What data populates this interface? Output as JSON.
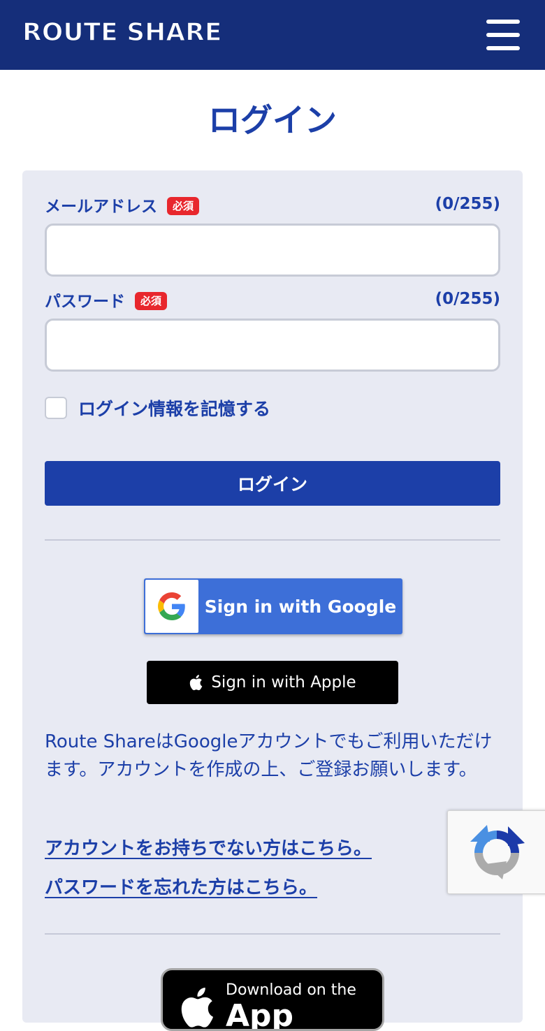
{
  "header": {
    "logo": "ROUTE SHARE"
  },
  "page": {
    "title": "ログイン"
  },
  "form": {
    "email": {
      "label": "メールアドレス",
      "required": "必須",
      "counter": "(0/255)",
      "value": "",
      "placeholder": ""
    },
    "password": {
      "label": "パスワード",
      "required": "必須",
      "counter": "(0/255)",
      "value": "",
      "placeholder": ""
    },
    "remember_label": "ログイン情報を記憶する",
    "submit_label": "ログイン"
  },
  "social": {
    "google_label": "Sign in with Google",
    "apple_label": "Sign in with Apple"
  },
  "info": {
    "text": "Route ShareはGoogleアカウントでもご利用いただけます。アカウントを作成の上、ご登録お願いします。"
  },
  "links": {
    "register": "アカウントをお持ちでない方はこちら。",
    "forgot": "パスワードを忘れた方はこちら。"
  },
  "appstore": {
    "small": "Download on the",
    "big": "App Store"
  },
  "colors": {
    "header": "#152e7a",
    "accent": "#1c3fa8",
    "required": "#e8272d",
    "google": "#3d6fd8"
  }
}
